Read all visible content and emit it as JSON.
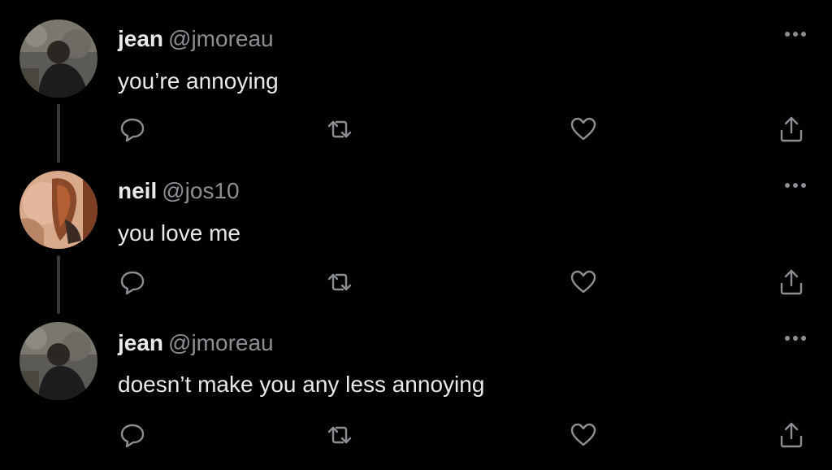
{
  "colors": {
    "background": "#000000",
    "primary_text": "#e7e9ea",
    "secondary_text": "#8b8f94",
    "icon": "#8b8f94",
    "thread_line": "#3a3a3a"
  },
  "tweets": [
    {
      "name": "jean",
      "handle": "@jmoreau",
      "text": "you’re annoying",
      "avatar_icon": "avatar-photo"
    },
    {
      "name": "neil",
      "handle": "@jos10",
      "text": "you love me",
      "avatar_icon": "avatar-photo"
    },
    {
      "name": "jean",
      "handle": "@jmoreau",
      "text": "doesn’t make you any less annoying",
      "avatar_icon": "avatar-photo"
    }
  ],
  "actions": {
    "reply_icon": "reply-icon",
    "retweet_icon": "retweet-icon",
    "like_icon": "heart-icon",
    "share_icon": "share-icon",
    "more_icon": "more-icon"
  }
}
